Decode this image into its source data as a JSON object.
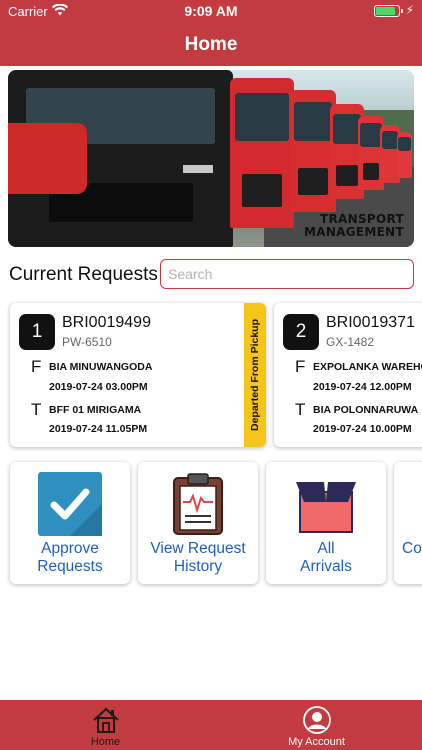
{
  "status_bar": {
    "carrier": "Carrier",
    "time": "9:09 AM"
  },
  "nav": {
    "title": "Home"
  },
  "banner": {
    "text_line1": "TRANSPORT",
    "text_line2": "MANAGEMENT"
  },
  "requests": {
    "section_title": "Current Requests",
    "search_placeholder": "Search",
    "items": [
      {
        "index": "1",
        "id": "BRI0019499",
        "vehicle": "PW-6510",
        "from_label": "F",
        "from_place": "BIA MINUWANGODA",
        "from_time": "2019-07-24  03.00PM",
        "to_label": "T",
        "to_place": "BFF 01 MIRIGAMA",
        "to_time": "2019-07-24  11.05PM",
        "status": "Departed From Pickup",
        "status_color": "#f5c518"
      },
      {
        "index": "2",
        "id": "BRI0019371",
        "vehicle": "GX-1482",
        "from_label": "F",
        "from_place": "EXPOLANKA WAREHOUSE",
        "from_time": "2019-07-24  12.00PM",
        "to_label": "T",
        "to_place": "BIA POLONNARUWA",
        "to_time": "2019-07-24  10.00PM"
      }
    ]
  },
  "tiles": [
    {
      "icon": "check-icon",
      "line1": "Approve",
      "line2": "Requests"
    },
    {
      "icon": "clipboard-icon",
      "line1": "View Request",
      "line2": "History"
    },
    {
      "icon": "box-icon",
      "line1": "All",
      "line2": "Arrivals"
    },
    {
      "icon": "unknown-icon",
      "line1": "",
      "line2": "Co"
    }
  ],
  "tabbar": {
    "home_label": "Home",
    "account_label": "My Account"
  },
  "colors": {
    "brand_red": "#c23b40",
    "link_blue": "#1f5fbf",
    "status_yellow": "#f5c518",
    "battery_green": "#4cd964"
  }
}
